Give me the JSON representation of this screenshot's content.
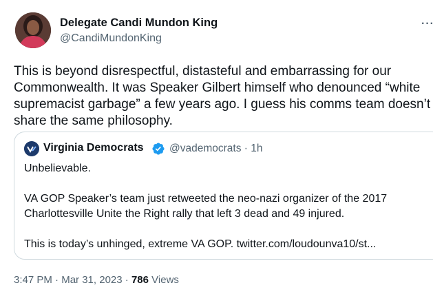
{
  "tweet": {
    "author_name": "Delegate Candi Mundon King",
    "author_handle": "@CandiMundonKing",
    "more_label": "···",
    "text_lines": [
      "This is beyond disrespectful, distasteful and embarrassing for our",
      "Commonwealth. It was Speaker Gilbert himself who denounced “white",
      "supremacist garbage” a few years ago. I guess his comms team doesn’t",
      "share the same philosophy."
    ]
  },
  "quote": {
    "author_name": "Virginia Democrats",
    "author_handle": "@vademocrats",
    "separator": " · ",
    "time": "1h",
    "lines": [
      "Unbelievable.",
      "",
      "VA GOP Speaker’s team just retweeted the neo-nazi organizer of the 2017",
      "Charlottesville Unite the Right rally that left 3 dead and 49 injured.",
      "",
      "This is today’s unhinged, extreme VA GOP. twitter.com/loudounva10/st..."
    ]
  },
  "meta": {
    "time": "3:47 PM",
    "separator": " · ",
    "date": "Mar 31, 2023",
    "views_count": "786",
    "views_label": "Views"
  },
  "colors": {
    "verified": "#1d9bf0",
    "secondary_text": "#536471",
    "border": "#cfd9de"
  }
}
